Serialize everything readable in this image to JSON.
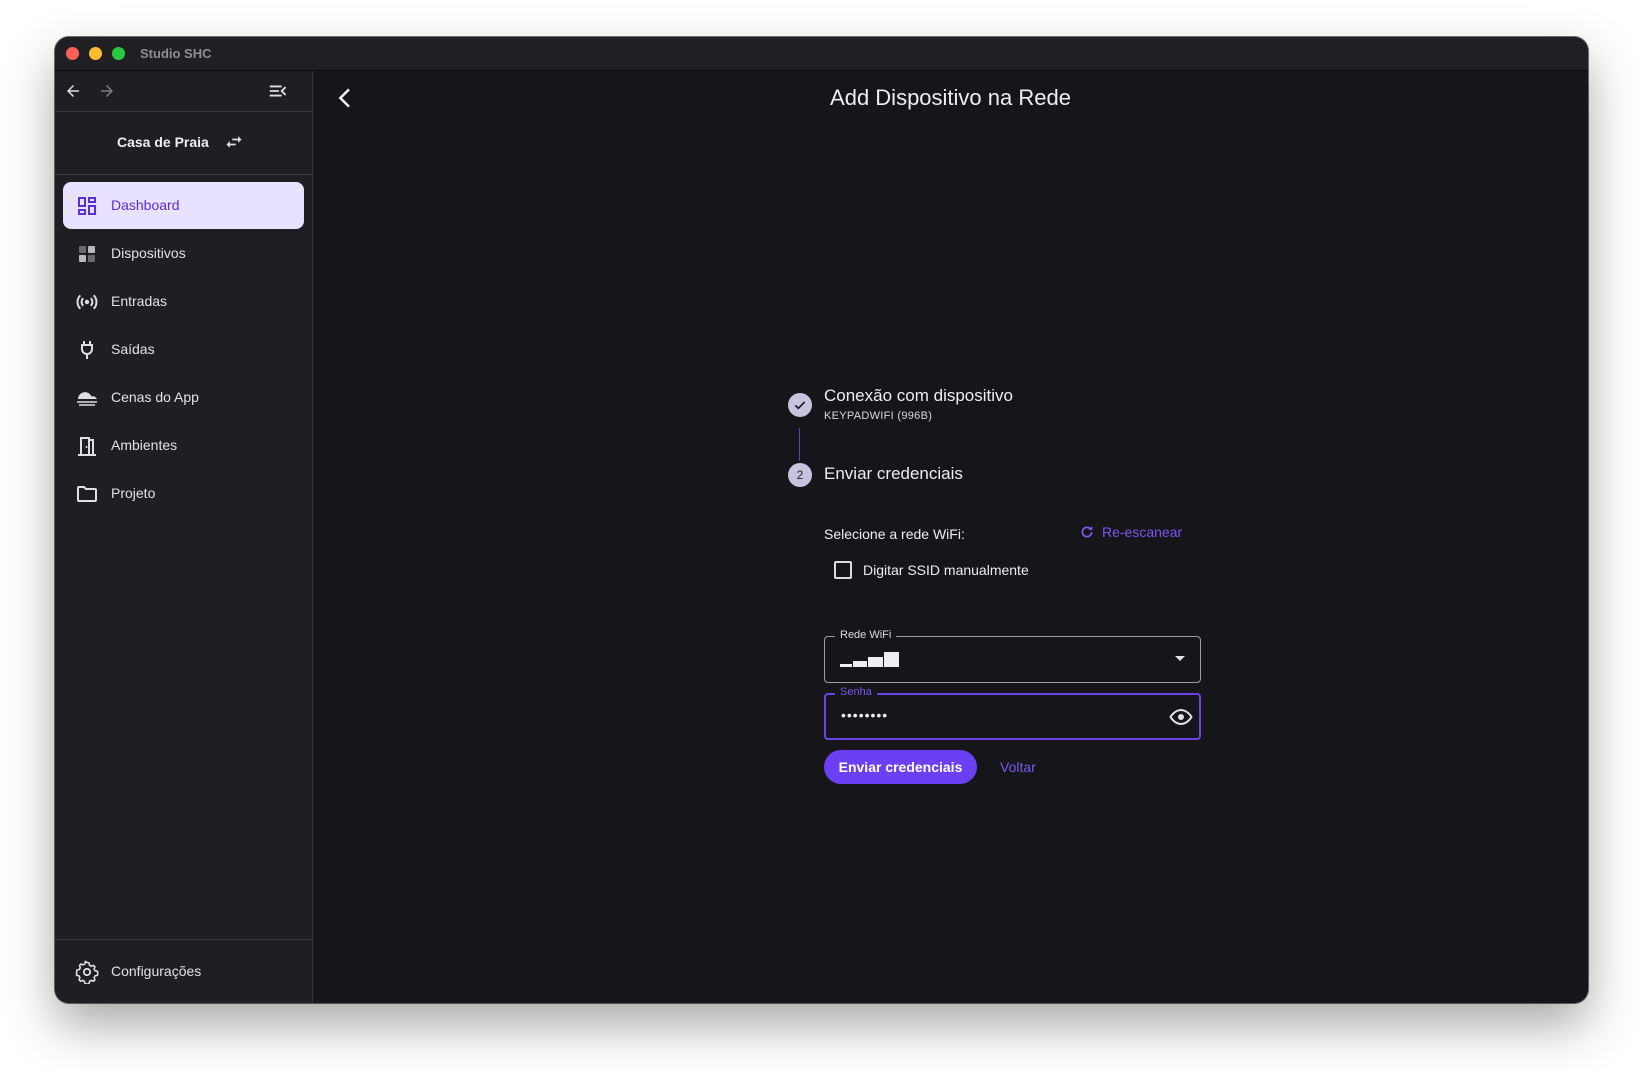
{
  "window": {
    "title": "Studio SHC"
  },
  "sidebar": {
    "project_name": "Casa de Praia",
    "items": [
      {
        "label": "Dashboard",
        "icon": "dashboard-icon",
        "active": true
      },
      {
        "label": "Dispositivos",
        "icon": "devices-icon",
        "active": false
      },
      {
        "label": "Entradas",
        "icon": "broadcast-icon",
        "active": false
      },
      {
        "label": "Saídas",
        "icon": "plug-icon",
        "active": false
      },
      {
        "label": "Cenas do App",
        "icon": "scene-icon",
        "active": false
      },
      {
        "label": "Ambientes",
        "icon": "door-icon",
        "active": false
      },
      {
        "label": "Projeto",
        "icon": "folder-icon",
        "active": false
      }
    ],
    "settings_label": "Configurações"
  },
  "main": {
    "title": "Add Dispositivo na Rede",
    "steps": [
      {
        "number": "1",
        "title": "Conexão com dispositivo",
        "subtitle": "KEYPADWIFI (996B)",
        "completed": true
      },
      {
        "number": "2",
        "title": "Enviar credenciais",
        "completed": false
      }
    ],
    "select_label": "Selecione a rede WiFi:",
    "rescan_label": "Re-escanear",
    "manual_ssid_label": "Digitar SSID manualmente",
    "manual_ssid_checked": false,
    "wifi_field": {
      "legend": "Rede WiFi"
    },
    "password_field": {
      "legend": "Senha",
      "value": "••••••••"
    },
    "submit_label": "Enviar credenciais",
    "back_label": "Voltar"
  },
  "colors": {
    "accent": "#6b3ff2",
    "accent_text": "#7c57f0",
    "active_bg": "#e8e2ff",
    "window_bg": "#15151a",
    "sidebar_bg": "#1f1f23"
  }
}
